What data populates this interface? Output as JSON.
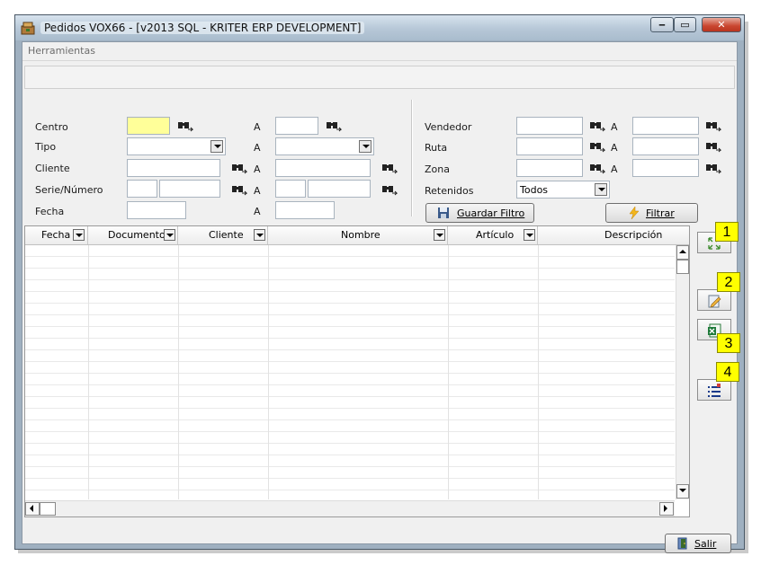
{
  "window": {
    "title": "Pedidos VOX66 - [v2013 SQL - KRITER ERP DEVELOPMENT]"
  },
  "menu": {
    "items": [
      "Herramientas"
    ]
  },
  "filters": {
    "range_sep": "A",
    "left": {
      "centro": {
        "label": "Centro",
        "from": "",
        "to": ""
      },
      "tipo": {
        "label": "Tipo",
        "from": "",
        "to": ""
      },
      "cliente": {
        "label": "Cliente",
        "from": "",
        "to": ""
      },
      "serie": {
        "label": "Serie/Número",
        "from_serie": "",
        "from_num": "",
        "to_serie": "",
        "to_num": ""
      },
      "fecha": {
        "label": "Fecha",
        "from": "",
        "to": ""
      }
    },
    "right": {
      "vendedor": {
        "label": "Vendedor",
        "from": "",
        "to": ""
      },
      "ruta": {
        "label": "Ruta",
        "from": "",
        "to": ""
      },
      "zona": {
        "label": "Zona",
        "from": "",
        "to": ""
      },
      "retenidos": {
        "label": "Retenidos",
        "value": "Todos"
      }
    },
    "buttons": {
      "save": "Guardar Filtro",
      "filter": "Filtrar"
    }
  },
  "grid": {
    "columns": [
      "Fecha",
      "Documento",
      "Cliente",
      "Nombre",
      "Artículo",
      "Descripción"
    ],
    "rows": []
  },
  "side_buttons": [
    {
      "icon": "expand-arrows-icon",
      "callout": "1"
    },
    {
      "icon": "edit-document-icon",
      "callout": "2"
    },
    {
      "icon": "excel-export-icon",
      "callout": "3"
    },
    {
      "icon": "list-settings-icon",
      "callout": "4"
    }
  ],
  "footer": {
    "exit": "Salir"
  },
  "colors": {
    "required_field": "#ffff99",
    "callout": "#ffff00"
  }
}
